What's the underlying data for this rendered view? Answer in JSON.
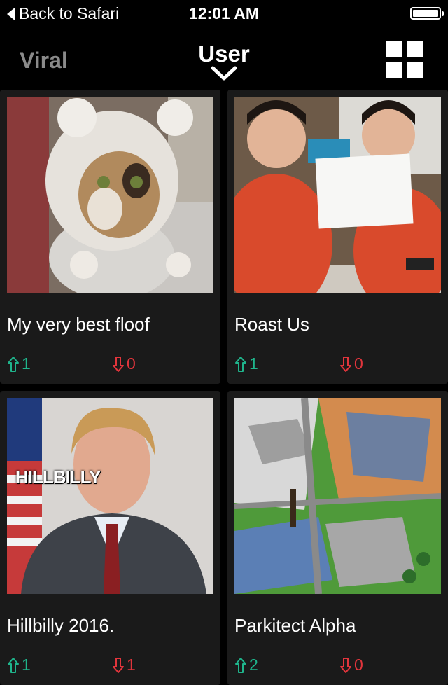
{
  "status_bar": {
    "back_label": "Back to Safari",
    "time": "12:01 AM",
    "battery_icon": "battery-full-icon"
  },
  "nav": {
    "left_tab": "Viral",
    "center_title": "User",
    "dropdown_icon": "chevron-down-icon",
    "layout_icon": "grid-icon"
  },
  "posts": [
    {
      "title": "My very best floof",
      "upvotes": "1",
      "downvotes": "0",
      "image": "cat-in-knit-hat-photo"
    },
    {
      "title": "Roast Us",
      "upvotes": "1",
      "downvotes": "0",
      "image": "two-guys-holding-sign-photo"
    },
    {
      "title": "Hillbilly 2016.",
      "upvotes": "1",
      "downvotes": "1",
      "image": "hillbilly-meme-photo",
      "image_caption": "HILLBILLY"
    },
    {
      "title": "Parkitect Alpha",
      "upvotes": "2",
      "downvotes": "0",
      "image": "theme-park-screenshot"
    }
  ],
  "colors": {
    "upvote": "#1fb58c",
    "downvote": "#e2353c",
    "card_bg": "#1a1a1a",
    "inactive_tab": "#8a8a8a"
  }
}
